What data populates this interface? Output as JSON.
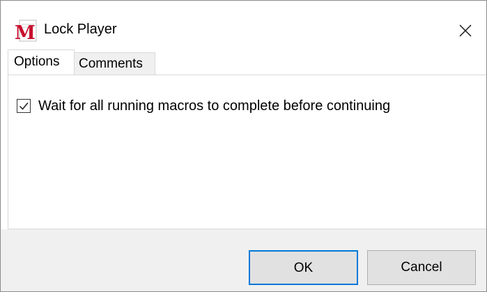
{
  "window": {
    "title": "Lock Player",
    "icon": "macro-m-icon",
    "close_icon": "close-icon"
  },
  "tabs": [
    {
      "label": "Options",
      "selected": true
    },
    {
      "label": "Comments",
      "selected": false
    }
  ],
  "options": {
    "wait_checkbox": {
      "label": "Wait for all running macros to complete before continuing",
      "checked": true
    }
  },
  "buttons": {
    "ok_label": "OK",
    "cancel_label": "Cancel"
  },
  "colors": {
    "icon_red": "#c8102e",
    "focus_blue": "#0078d7",
    "footer_bg": "#f0f0f0"
  }
}
